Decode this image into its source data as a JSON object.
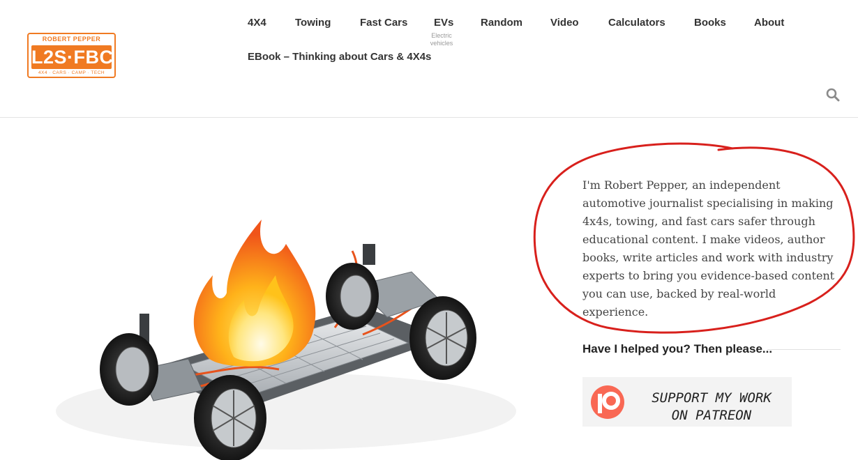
{
  "logo": {
    "top_text": "ROBERT PEPPER",
    "main_text": "L2S·FBC",
    "bottom_text": "4X4 · CARS · CAMP · TECH"
  },
  "nav": {
    "items": [
      {
        "label": "4X4"
      },
      {
        "label": "Towing"
      },
      {
        "label": "Fast Cars"
      },
      {
        "label": "EVs",
        "sublabel": "Electric vehicles"
      },
      {
        "label": "Random"
      },
      {
        "label": "Video"
      },
      {
        "label": "Calculators"
      },
      {
        "label": "Books"
      },
      {
        "label": "About"
      },
      {
        "label": "EBook – Thinking about Cars & 4X4s"
      }
    ],
    "search_icon": "search-icon"
  },
  "hero": {
    "image": "ev-chassis-on-fire-illustration"
  },
  "sidebar": {
    "intro": "I'm Robert Pepper, an independent automotive journalist specialising in making 4x4s, towing, and fast cars safer through educational content. I make videos, author books, write articles and work with industry experts to bring you evidence-based content you can use, backed by real-world experience.",
    "annotation": "red-hand-drawn-circle",
    "helped_heading": "Have I helped you? Then please...",
    "patreon": {
      "line1": "SUPPORT MY WORK",
      "line2": "ON PATREON",
      "color": "#f96854"
    }
  },
  "colors": {
    "brand_orange": "#f07a22",
    "annotation_red": "#d8201c"
  }
}
